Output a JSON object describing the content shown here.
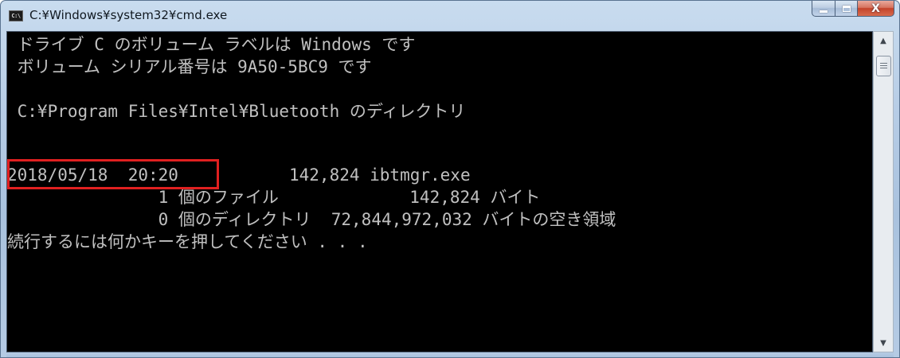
{
  "window": {
    "title": "C:¥Windows¥system32¥cmd.exe",
    "icon_label": "C:\\",
    "close_glyph": "X"
  },
  "console": {
    "lines": [
      " ドライブ C のボリューム ラベルは Windows です",
      " ボリューム シリアル番号は 9A50-5BC9 です",
      "",
      " C:¥Program Files¥Intel¥Bluetooth のディレクトリ",
      "",
      "2018/05/18  20:20           142,824 ibtmgr.exe",
      "               1 個のファイル             142,824 バイト",
      "               0 個のディレクトリ  72,844,972,032 バイトの空き領域",
      "続行するには何かキーを押してください . . ."
    ],
    "text_color": "#c0c0c0",
    "background": "#000000"
  },
  "highlight": {
    "color": "#e02020",
    "target_line": 5
  },
  "icons": {
    "app": "cmd-icon",
    "minimize": "minimize-icon",
    "maximize": "maximize-icon",
    "close": "close-icon",
    "scroll_up": "arrow-up-icon",
    "scroll_down": "arrow-down-icon"
  }
}
